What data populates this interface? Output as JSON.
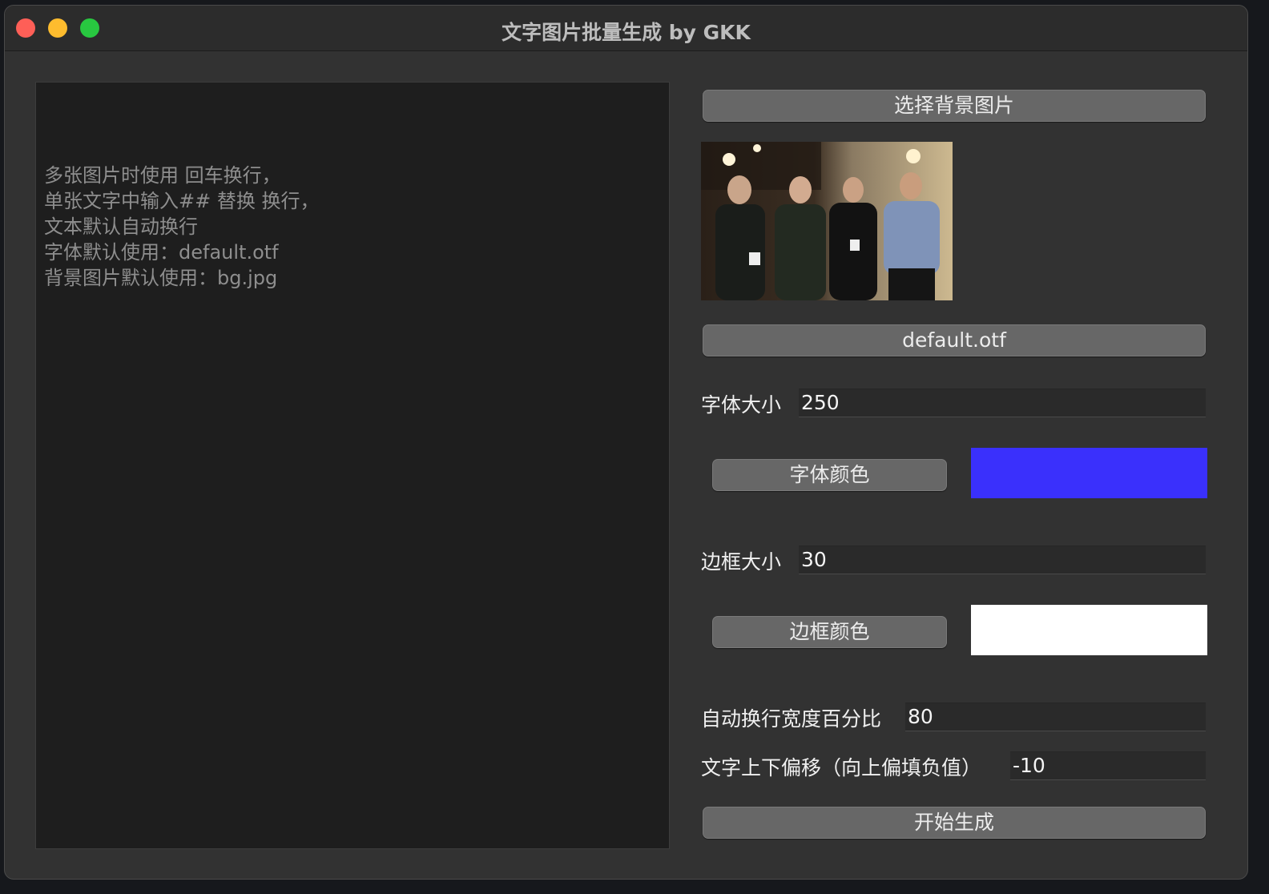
{
  "window": {
    "title": "文字图片批量生成 by GKK"
  },
  "textarea": {
    "placeholder": "多张图片时使用 回车换行，\n单张文字中输入## 替换 换行，\n文本默认自动换行\n字体默认使用：default.otf\n背景图片默认使用：bg.jpg"
  },
  "controls": {
    "choose_bg_label": "选择背景图片",
    "font_button_label": "default.otf",
    "font_size_label": "字体大小",
    "font_size_value": "250",
    "font_color_label": "字体颜色",
    "font_color_value": "#3a30fc",
    "border_size_label": "边框大小",
    "border_size_value": "30",
    "border_color_label": "边框颜色",
    "border_color_value": "#ffffff",
    "wrap_width_label": "自动换行宽度百分比",
    "wrap_width_value": "80",
    "offset_label": "文字上下偏移（向上偏填负值）",
    "offset_value": "-10",
    "start_label": "开始生成"
  }
}
